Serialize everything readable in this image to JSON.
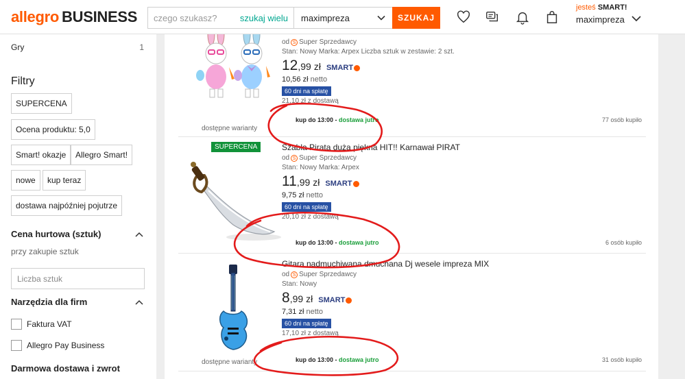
{
  "header": {
    "logo_brand": "allegro",
    "logo_suffix": "BUSINESS",
    "search_placeholder": "czego szukasz?",
    "search_many": "szukaj wielu",
    "category_value": "maximpreza",
    "search_button": "SZUKAJ",
    "smart_prefix": "jesteś",
    "smart_label": "SMART!",
    "user_name": "maximpreza",
    "icons": [
      "heart-icon",
      "chat-icon",
      "bell-icon",
      "bag-icon",
      "chevron-down-icon"
    ]
  },
  "sidebar": {
    "category": {
      "label": "Gry",
      "count": "1"
    },
    "filters_title": "Filtry",
    "chips": [
      "SUPERCENA",
      "Ocena produktu: 5,0",
      "Smart! okazje",
      "Allegro Smart!",
      "nowe",
      "kup teraz",
      "dostawa najpóźniej pojutrze"
    ],
    "wholesale_title": "Cena hurtowa (sztuk)",
    "wholesale_hint": "przy zakupie sztuk",
    "qty_placeholder": "Liczba sztuk",
    "tools_title": "Narzędzia dla firm",
    "checkboxes": [
      "Faktura VAT",
      "Allegro Pay Business"
    ],
    "free_delivery_title": "Darmowa dostawa i zwrot"
  },
  "listings": [
    {
      "title": "",
      "seller_prefix": "od",
      "seller": "Super Sprzedawcy",
      "meta": "Stan: Nowy  Marka: Arpex  Liczba sztuk w zestawie: 2 szt.",
      "price_int": "12",
      "price_dec": ",99",
      "currency": "zł",
      "smart": "SMART",
      "net": "10,56 zł",
      "net_label": "netto",
      "pay_badge": "60 dni na spłatę",
      "delivery_cost": "21,10 zł z dostawą",
      "shipping_prefix": "kup do 13:00 -",
      "shipping_green": "dostawa jutro",
      "bought": "77 osób kupiło",
      "variants": "dostępne warianty",
      "badge": ""
    },
    {
      "title": "Szabla Pirata duża piękna HIT!! Karnawał PIRAT",
      "seller_prefix": "od",
      "seller": "Super Sprzedawcy",
      "meta": "Stan: Nowy  Marka: Arpex",
      "price_int": "11",
      "price_dec": ",99",
      "currency": "zł",
      "smart": "SMART",
      "net": "9,75 zł",
      "net_label": "netto",
      "pay_badge": "60 dni na spłatę",
      "delivery_cost": "20,10 zł z dostawą",
      "shipping_prefix": "kup do 13:00 -",
      "shipping_green": "dostawa jutro",
      "bought": "6 osób kupiło",
      "variants": "",
      "badge": "SUPERCENA"
    },
    {
      "title": "Gitara nadmuchiwana dmuchana Dj wesele impreza MIX",
      "seller_prefix": "od",
      "seller": "Super Sprzedawcy",
      "meta": "Stan: Nowy",
      "price_int": "8",
      "price_dec": ",99",
      "currency": "zł",
      "smart": "SMART",
      "net": "7,31 zł",
      "net_label": "netto",
      "pay_badge": "60 dni na spłatę",
      "delivery_cost": "17,10 zł z dostawą",
      "shipping_prefix": "kup do 13:00 -",
      "shipping_green": "dostawa jutro",
      "bought": "31 osób kupiło",
      "variants": "dostępne warianty",
      "badge": ""
    }
  ],
  "colors": {
    "accent": "#ff5a00",
    "green": "#1a9e3a",
    "pay_blue": "#2751a4",
    "annotation_red": "#e31b1b"
  }
}
